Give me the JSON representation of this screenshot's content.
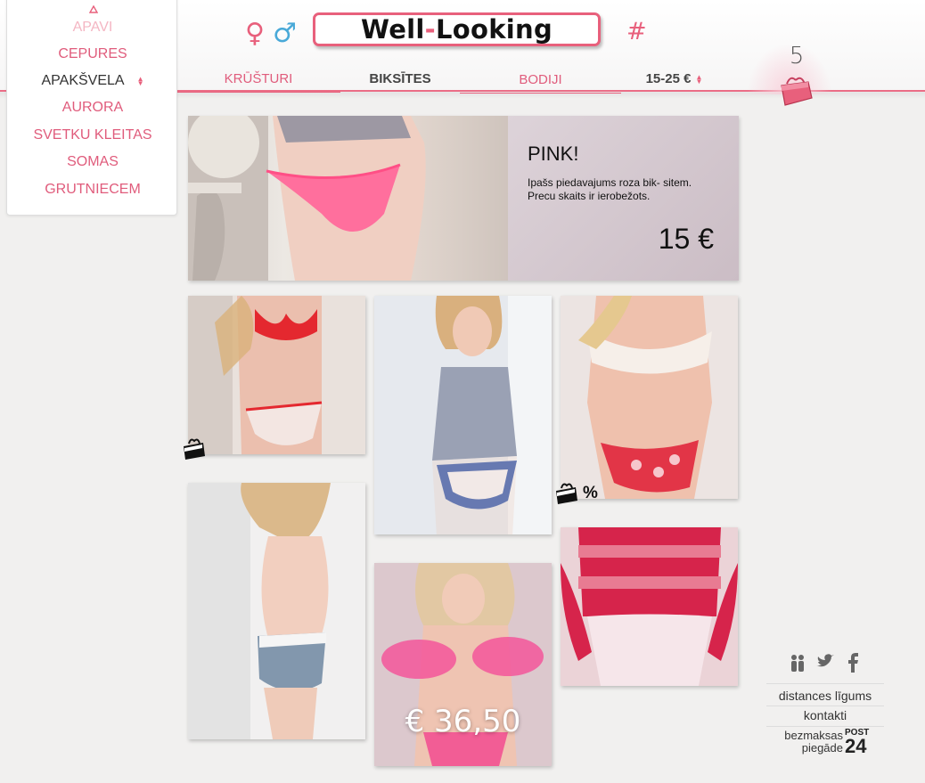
{
  "header": {
    "logo_text_part1": "Well",
    "logo_text_dash": "-",
    "logo_text_part2": "Looking",
    "female_symbol": "♀",
    "male_symbol": "♂",
    "hash_symbol": "#",
    "accent_color": "#e8607c",
    "male_color": "#49a9d8",
    "cart_count": "5"
  },
  "nav": {
    "items": [
      {
        "label": "KRŪŠTURI"
      },
      {
        "label": "BIKSĪTES"
      },
      {
        "label": "BODIJI"
      },
      {
        "label": "15-25 €"
      }
    ]
  },
  "dropdown": {
    "items": [
      {
        "label": "APAVI"
      },
      {
        "label": "CEPURES"
      },
      {
        "label": "APAKŠVELA"
      },
      {
        "label": "AURORA"
      },
      {
        "label": "SVETKU KLEITAS"
      },
      {
        "label": "SOMAS"
      },
      {
        "label": "GRUTNIECEM"
      }
    ]
  },
  "banner": {
    "title": "PINK!",
    "description": "Ipašs piedavajums roza bik- sitem. Precu skaits ir ierobežots.",
    "price": "15 €"
  },
  "products": {
    "price_tag": "€ 36,50",
    "discount_symbol": "%"
  },
  "footer": {
    "links": [
      {
        "label": "distances līgums"
      },
      {
        "label": "kontakti"
      }
    ],
    "shipping_line1": "bezmaksas",
    "shipping_line2": "piegāde",
    "post_label": "POST",
    "post_number": "24",
    "social_icons": [
      "people-icon",
      "twitter-icon",
      "facebook-icon"
    ]
  }
}
